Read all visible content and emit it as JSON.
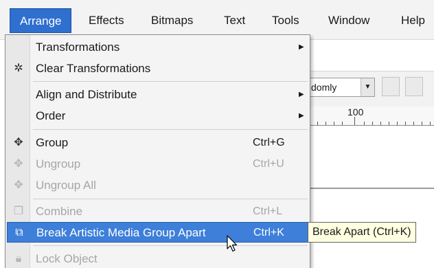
{
  "menubar": {
    "items": [
      "Arrange",
      "Effects",
      "Bitmaps",
      "Text",
      "Tools",
      "Window",
      "Help"
    ]
  },
  "background": {
    "combo_text": "domly",
    "ruler_label": "100"
  },
  "menu": {
    "items": [
      {
        "label": "Transformations",
        "shortcut": "",
        "icon": "",
        "state": "enabled"
      },
      {
        "label": "Clear Transformations",
        "shortcut": "",
        "icon": "clear-transformations-icon",
        "state": "enabled"
      },
      {
        "label": "Align and Distribute",
        "shortcut": "",
        "icon": "",
        "state": "enabled"
      },
      {
        "label": "Order",
        "shortcut": "",
        "icon": "",
        "state": "enabled"
      },
      {
        "label": "Group",
        "shortcut": "Ctrl+G",
        "icon": "group-icon",
        "state": "enabled"
      },
      {
        "label": "Ungroup",
        "shortcut": "Ctrl+U",
        "icon": "ungroup-icon",
        "state": "disabled"
      },
      {
        "label": "Ungroup All",
        "shortcut": "",
        "icon": "ungroup-all-icon",
        "state": "disabled"
      },
      {
        "label": "Combine",
        "shortcut": "Ctrl+L",
        "icon": "combine-icon",
        "state": "disabled"
      },
      {
        "label": "Break Artistic Media Group Apart",
        "shortcut": "Ctrl+K",
        "icon": "break-apart-icon",
        "state": "highlighted"
      },
      {
        "label": "Lock Object",
        "shortcut": "",
        "icon": "lock-icon",
        "state": "disabled"
      }
    ]
  },
  "tooltip": {
    "text": "Break Apart (Ctrl+K)"
  },
  "colors": {
    "highlight": "#3d7fd9",
    "tooltip_bg": "#ffffe1",
    "disabled_text": "#a6a6a6"
  }
}
